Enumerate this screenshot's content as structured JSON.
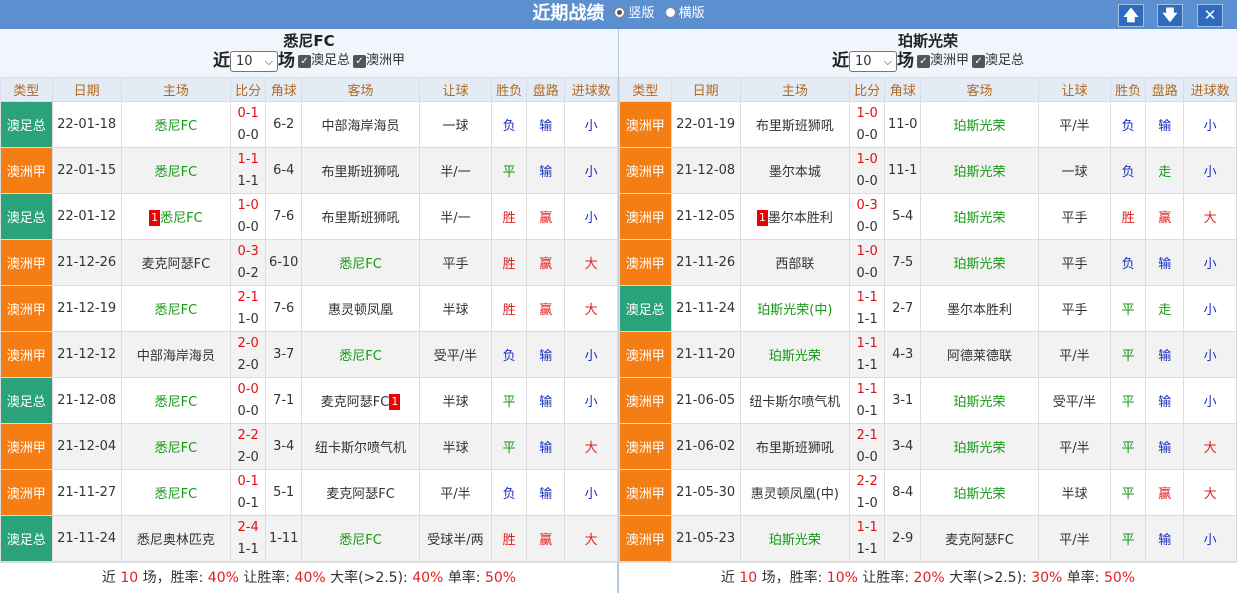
{
  "header": {
    "title": "近期战绩",
    "opt1": "竖版",
    "opt2": "横版"
  },
  "icons": {
    "up": "arrow-up-icon",
    "down": "arrow-down-icon",
    "close": "close-icon"
  },
  "colors": {
    "league_orange": "#f47d14",
    "league_green": "#2aa27a",
    "win": "#e02020",
    "draw": "#139913",
    "loss": "#1a2fc0"
  },
  "left": {
    "team": "悉尼FC",
    "prefix": "近",
    "count": "10",
    "suffix": "场",
    "filters": [
      "澳足总",
      "澳洲甲"
    ],
    "columns": [
      "类型",
      "日期",
      "主场",
      "比分",
      "角球",
      "客场",
      "让球",
      "胜负",
      "盘路",
      "进球数"
    ],
    "rows": [
      {
        "type": "澳足总",
        "color": "green",
        "date": "22-01-18",
        "home": "悉尼FC",
        "home_hl": true,
        "home_rc": "",
        "score": "0-1",
        "ht": "0-0",
        "corner": "6-2",
        "away": "中部海岸海员",
        "away_hl": false,
        "away_rc": "",
        "hcp": "一球",
        "wl": "负",
        "pan": "输",
        "ou": "小"
      },
      {
        "type": "澳洲甲",
        "color": "orange",
        "date": "22-01-15",
        "home": "悉尼FC",
        "home_hl": true,
        "home_rc": "",
        "score": "1-1",
        "ht": "1-1",
        "corner": "6-4",
        "away": "布里斯班狮吼",
        "away_hl": false,
        "away_rc": "",
        "hcp": "半/一",
        "wl": "平",
        "pan": "输",
        "ou": "小"
      },
      {
        "type": "澳足总",
        "color": "green",
        "date": "22-01-12",
        "home": "悉尼FC",
        "home_hl": true,
        "home_rc": "1",
        "score": "1-0",
        "ht": "0-0",
        "corner": "7-6",
        "away": "布里斯班狮吼",
        "away_hl": false,
        "away_rc": "",
        "hcp": "半/一",
        "wl": "胜",
        "pan": "赢",
        "ou": "小"
      },
      {
        "type": "澳洲甲",
        "color": "orange",
        "date": "21-12-26",
        "home": "麦克阿瑟FC",
        "home_hl": false,
        "home_rc": "",
        "score": "0-3",
        "ht": "0-2",
        "corner": "6-10",
        "away": "悉尼FC",
        "away_hl": true,
        "away_rc": "",
        "hcp": "平手",
        "wl": "胜",
        "pan": "赢",
        "ou": "大"
      },
      {
        "type": "澳洲甲",
        "color": "orange",
        "date": "21-12-19",
        "home": "悉尼FC",
        "home_hl": true,
        "home_rc": "",
        "score": "2-1",
        "ht": "1-0",
        "corner": "7-6",
        "away": "惠灵顿凤凰",
        "away_hl": false,
        "away_rc": "",
        "hcp": "半球",
        "wl": "胜",
        "pan": "赢",
        "ou": "大"
      },
      {
        "type": "澳洲甲",
        "color": "orange",
        "date": "21-12-12",
        "home": "中部海岸海员",
        "home_hl": false,
        "home_rc": "",
        "score": "2-0",
        "ht": "2-0",
        "corner": "3-7",
        "away": "悉尼FC",
        "away_hl": true,
        "away_rc": "",
        "hcp": "受平/半",
        "wl": "负",
        "pan": "输",
        "ou": "小"
      },
      {
        "type": "澳足总",
        "color": "green",
        "date": "21-12-08",
        "home": "悉尼FC",
        "home_hl": true,
        "home_rc": "",
        "score": "0-0",
        "ht": "0-0",
        "corner": "7-1",
        "away": "麦克阿瑟FC",
        "away_hl": false,
        "away_rc": "1",
        "hcp": "半球",
        "wl": "平",
        "pan": "输",
        "ou": "小"
      },
      {
        "type": "澳洲甲",
        "color": "orange",
        "date": "21-12-04",
        "home": "悉尼FC",
        "home_hl": true,
        "home_rc": "",
        "score": "2-2",
        "ht": "2-0",
        "corner": "3-4",
        "away": "纽卡斯尔喷气机",
        "away_hl": false,
        "away_rc": "",
        "hcp": "半球",
        "wl": "平",
        "pan": "输",
        "ou": "大"
      },
      {
        "type": "澳洲甲",
        "color": "orange",
        "date": "21-11-27",
        "home": "悉尼FC",
        "home_hl": true,
        "home_rc": "",
        "score": "0-1",
        "ht": "0-1",
        "corner": "5-1",
        "away": "麦克阿瑟FC",
        "away_hl": false,
        "away_rc": "",
        "hcp": "平/半",
        "wl": "负",
        "pan": "输",
        "ou": "小"
      },
      {
        "type": "澳足总",
        "color": "green",
        "date": "21-11-24",
        "home": "悉尼奥林匹克",
        "home_hl": false,
        "home_rc": "",
        "score": "2-4",
        "ht": "1-1",
        "corner": "1-11",
        "away": "悉尼FC",
        "away_hl": true,
        "away_rc": "",
        "hcp": "受球半/两",
        "wl": "胜",
        "pan": "赢",
        "ou": "大"
      }
    ],
    "footer": {
      "t1": "近 ",
      "n": "10",
      "t2": " 场，胜率: ",
      "win": "40%",
      "t3": " 让胜率: ",
      "hcpwin": "40%",
      "t4": " 大率(>2.5): ",
      "big": "40%",
      "t5": " 单率: ",
      "odd": "50%"
    }
  },
  "right": {
    "team": "珀斯光荣",
    "prefix": "近",
    "count": "10",
    "suffix": "场",
    "filters": [
      "澳洲甲",
      "澳足总"
    ],
    "columns": [
      "类型",
      "日期",
      "主场",
      "比分",
      "角球",
      "客场",
      "让球",
      "胜负",
      "盘路",
      "进球数"
    ],
    "rows": [
      {
        "type": "澳洲甲",
        "color": "orange",
        "date": "22-01-19",
        "home": "布里斯班狮吼",
        "home_hl": false,
        "home_rc": "",
        "score": "1-0",
        "ht": "0-0",
        "corner": "11-0",
        "away": "珀斯光荣",
        "away_hl": true,
        "away_rc": "",
        "hcp": "平/半",
        "wl": "负",
        "pan": "输",
        "ou": "小"
      },
      {
        "type": "澳洲甲",
        "color": "orange",
        "date": "21-12-08",
        "home": "墨尔本城",
        "home_hl": false,
        "home_rc": "",
        "score": "1-0",
        "ht": "0-0",
        "corner": "11-1",
        "away": "珀斯光荣",
        "away_hl": true,
        "away_rc": "",
        "hcp": "一球",
        "wl": "负",
        "pan": "走",
        "ou": "小"
      },
      {
        "type": "澳洲甲",
        "color": "orange",
        "date": "21-12-05",
        "home": "墨尔本胜利",
        "home_hl": false,
        "home_rc": "1",
        "score": "0-3",
        "ht": "0-0",
        "corner": "5-4",
        "away": "珀斯光荣",
        "away_hl": true,
        "away_rc": "",
        "hcp": "平手",
        "wl": "胜",
        "pan": "赢",
        "ou": "大"
      },
      {
        "type": "澳洲甲",
        "color": "orange",
        "date": "21-11-26",
        "home": "西部联",
        "home_hl": false,
        "home_rc": "",
        "score": "1-0",
        "ht": "0-0",
        "corner": "7-5",
        "away": "珀斯光荣",
        "away_hl": true,
        "away_rc": "",
        "hcp": "平手",
        "wl": "负",
        "pan": "输",
        "ou": "小"
      },
      {
        "type": "澳足总",
        "color": "green",
        "date": "21-11-24",
        "home": "珀斯光荣(中)",
        "home_hl": true,
        "home_rc": "",
        "score": "1-1",
        "ht": "1-1",
        "corner": "2-7",
        "away": "墨尔本胜利",
        "away_hl": false,
        "away_rc": "",
        "hcp": "平手",
        "wl": "平",
        "pan": "走",
        "ou": "小"
      },
      {
        "type": "澳洲甲",
        "color": "orange",
        "date": "21-11-20",
        "home": "珀斯光荣",
        "home_hl": true,
        "home_rc": "",
        "score": "1-1",
        "ht": "1-1",
        "corner": "4-3",
        "away": "阿德莱德联",
        "away_hl": false,
        "away_rc": "",
        "hcp": "平/半",
        "wl": "平",
        "pan": "输",
        "ou": "小"
      },
      {
        "type": "澳洲甲",
        "color": "orange",
        "date": "21-06-05",
        "home": "纽卡斯尔喷气机",
        "home_hl": false,
        "home_rc": "",
        "score": "1-1",
        "ht": "0-1",
        "corner": "3-1",
        "away": "珀斯光荣",
        "away_hl": true,
        "away_rc": "",
        "hcp": "受平/半",
        "wl": "平",
        "pan": "输",
        "ou": "小"
      },
      {
        "type": "澳洲甲",
        "color": "orange",
        "date": "21-06-02",
        "home": "布里斯班狮吼",
        "home_hl": false,
        "home_rc": "",
        "score": "2-1",
        "ht": "0-0",
        "corner": "3-4",
        "away": "珀斯光荣",
        "away_hl": true,
        "away_rc": "",
        "hcp": "平/半",
        "wl": "平",
        "pan": "输",
        "ou": "大"
      },
      {
        "type": "澳洲甲",
        "color": "orange",
        "date": "21-05-30",
        "home": "惠灵顿凤凰(中)",
        "home_hl": false,
        "home_rc": "",
        "score": "2-2",
        "ht": "1-0",
        "corner": "8-4",
        "away": "珀斯光荣",
        "away_hl": true,
        "away_rc": "",
        "hcp": "半球",
        "wl": "平",
        "pan": "赢",
        "ou": "大"
      },
      {
        "type": "澳洲甲",
        "color": "orange",
        "date": "21-05-23",
        "home": "珀斯光荣",
        "home_hl": true,
        "home_rc": "",
        "score": "1-1",
        "ht": "1-1",
        "corner": "2-9",
        "away": "麦克阿瑟FC",
        "away_hl": false,
        "away_rc": "",
        "hcp": "平/半",
        "wl": "平",
        "pan": "输",
        "ou": "小"
      }
    ],
    "footer": {
      "t1": "近 ",
      "n": "10",
      "t2": " 场，胜率: ",
      "win": "10%",
      "t3": " 让胜率: ",
      "hcpwin": "20%",
      "t4": " 大率(>2.5): ",
      "big": "30%",
      "t5": " 单率: ",
      "odd": "50%"
    }
  }
}
